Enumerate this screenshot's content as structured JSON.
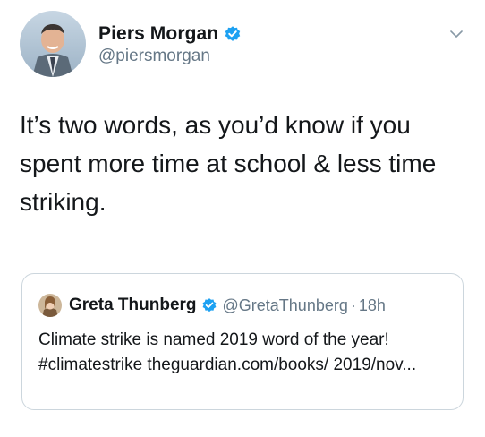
{
  "author": {
    "name": "Piers Morgan",
    "handle": "@piersmorgan",
    "verified": true
  },
  "tweet": {
    "text": "It’s two words, as you’d know if you spent more time at school & less time striking."
  },
  "quoted_tweet": {
    "name": "Greta Thunberg",
    "handle": "@GretaThunberg",
    "separator": "·",
    "time": "18h",
    "verified": true,
    "text": "Climate strike is named 2019 word of the year! #climatestrike theguardian.com/books/ 2019/nov..."
  },
  "colors": {
    "verified_badge": "#1da1f2",
    "text_primary": "#14171a",
    "text_secondary": "#657786",
    "border": "#ccd6dd"
  },
  "icons": {
    "verified": "verified-badge-icon",
    "menu": "chevron-down-icon"
  }
}
